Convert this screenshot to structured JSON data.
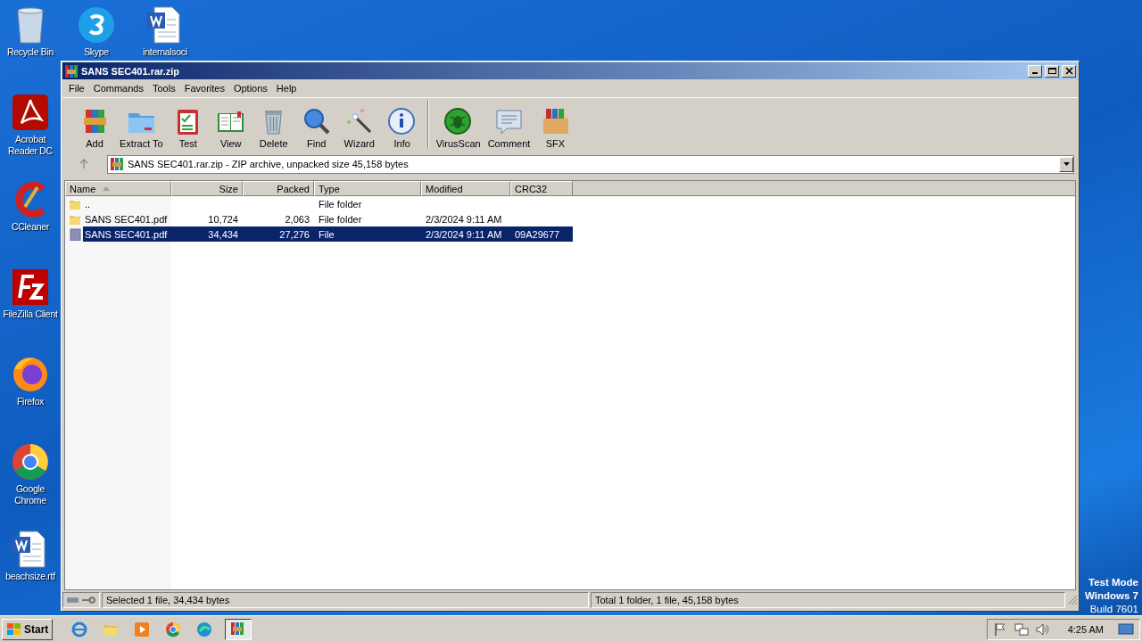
{
  "desktop_icons": [
    {
      "label": "Recycle Bin"
    },
    {
      "label": "Skype"
    },
    {
      "label": "internalsoci"
    },
    {
      "label": "Acrobat Reader DC"
    },
    {
      "label": "CCleaner"
    },
    {
      "label": "FileZilla Client"
    },
    {
      "label": "Firefox"
    },
    {
      "label": "Google Chrome"
    },
    {
      "label": "beachsize.rtf"
    }
  ],
  "window": {
    "title": "SANS SEC401.rar.zip",
    "menu": [
      "File",
      "Commands",
      "Tools",
      "Favorites",
      "Options",
      "Help"
    ],
    "toolbar": [
      {
        "label": "Add"
      },
      {
        "label": "Extract To"
      },
      {
        "label": "Test"
      },
      {
        "label": "View"
      },
      {
        "label": "Delete"
      },
      {
        "label": "Find"
      },
      {
        "label": "Wizard"
      },
      {
        "label": "Info"
      },
      {
        "label": "VirusScan"
      },
      {
        "label": "Comment"
      },
      {
        "label": "SFX"
      }
    ],
    "address": "SANS SEC401.rar.zip - ZIP archive, unpacked size 45,158 bytes",
    "columns": [
      {
        "label": "Name",
        "sorted": true
      },
      {
        "label": "Size",
        "sorted": false
      },
      {
        "label": "Packed",
        "sorted": false
      },
      {
        "label": "Type",
        "sorted": false
      },
      {
        "label": "Modified",
        "sorted": false
      },
      {
        "label": "CRC32",
        "sorted": false
      }
    ],
    "rows": [
      {
        "kind": "folder",
        "selected": false,
        "cells": [
          "..",
          null,
          null,
          "File folder",
          null,
          null
        ]
      },
      {
        "kind": "folder",
        "selected": false,
        "cells": [
          "SANS SEC401.pdf",
          "10,724",
          "2,063",
          "File folder",
          "2/3/2024 9:11 AM",
          null
        ]
      },
      {
        "kind": "file",
        "selected": true,
        "cells": [
          "SANS SEC401.pdf",
          "34,434",
          "27,276",
          "File",
          "2/3/2024 9:11 AM",
          "09A29677"
        ]
      }
    ],
    "status_left": "Selected 1 file, 34,434 bytes",
    "status_right": "Total 1 folder, 1 file, 45,158 bytes"
  },
  "os_notice": [
    "Test Mode",
    "Windows 7",
    "Build 7601"
  ],
  "taskbar": {
    "start": "Start",
    "apps": [
      {
        "active": false
      },
      {
        "active": false
      },
      {
        "active": false
      },
      {
        "active": false
      },
      {
        "active": false
      },
      {
        "active": true
      }
    ],
    "clock": "4:25 AM"
  }
}
